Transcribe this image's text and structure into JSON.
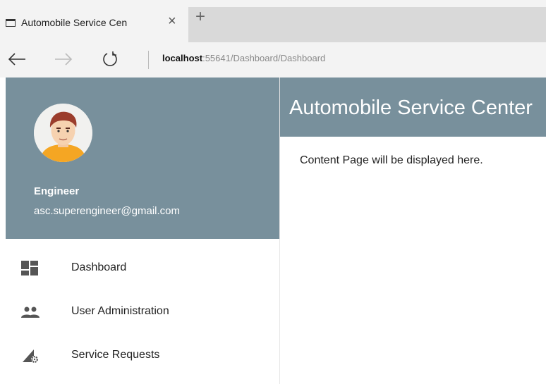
{
  "browser": {
    "tab_title": "Automobile Service Cen",
    "tab_close": "×",
    "new_tab": "+",
    "address_host": "localhost",
    "address_rest": ":55641/Dashboard/Dashboard"
  },
  "sidebar": {
    "user_name": "Engineer",
    "user_email": "asc.superengineer@gmail.com",
    "header_color": "#78909c",
    "items": [
      {
        "label": "Dashboard",
        "icon": "dashboard-icon"
      },
      {
        "label": "User Administration",
        "icon": "users-icon"
      },
      {
        "label": "Service Requests",
        "icon": "service-requests-icon"
      }
    ]
  },
  "main": {
    "title": "Automobile Service Center",
    "content": "Content Page will be displayed here."
  }
}
